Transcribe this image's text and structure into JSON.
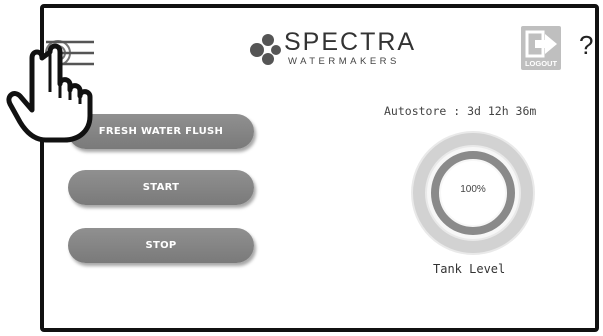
{
  "brand": {
    "name": "SPECTRA",
    "subtitle": "WATERMAKERS"
  },
  "header": {
    "logout_label": "LOGOUT",
    "help_label": "?"
  },
  "buttons": {
    "fresh_water_flush": "FRESH WATER FLUSH",
    "start": "START",
    "stop": "STOP"
  },
  "autostore": {
    "text": "Autostore : 3d 12h 36m"
  },
  "tank": {
    "level_percent": 100,
    "level_text": "100%",
    "label": "Tank Level"
  },
  "icons": [
    "menu-icon",
    "spectra-logo-icon",
    "logout-icon",
    "help-icon",
    "pointing-hand-icon"
  ],
  "colors": {
    "button": "#858585",
    "gauge_outer": "#d5d5d5",
    "gauge_inner": "#8a8a8a"
  }
}
